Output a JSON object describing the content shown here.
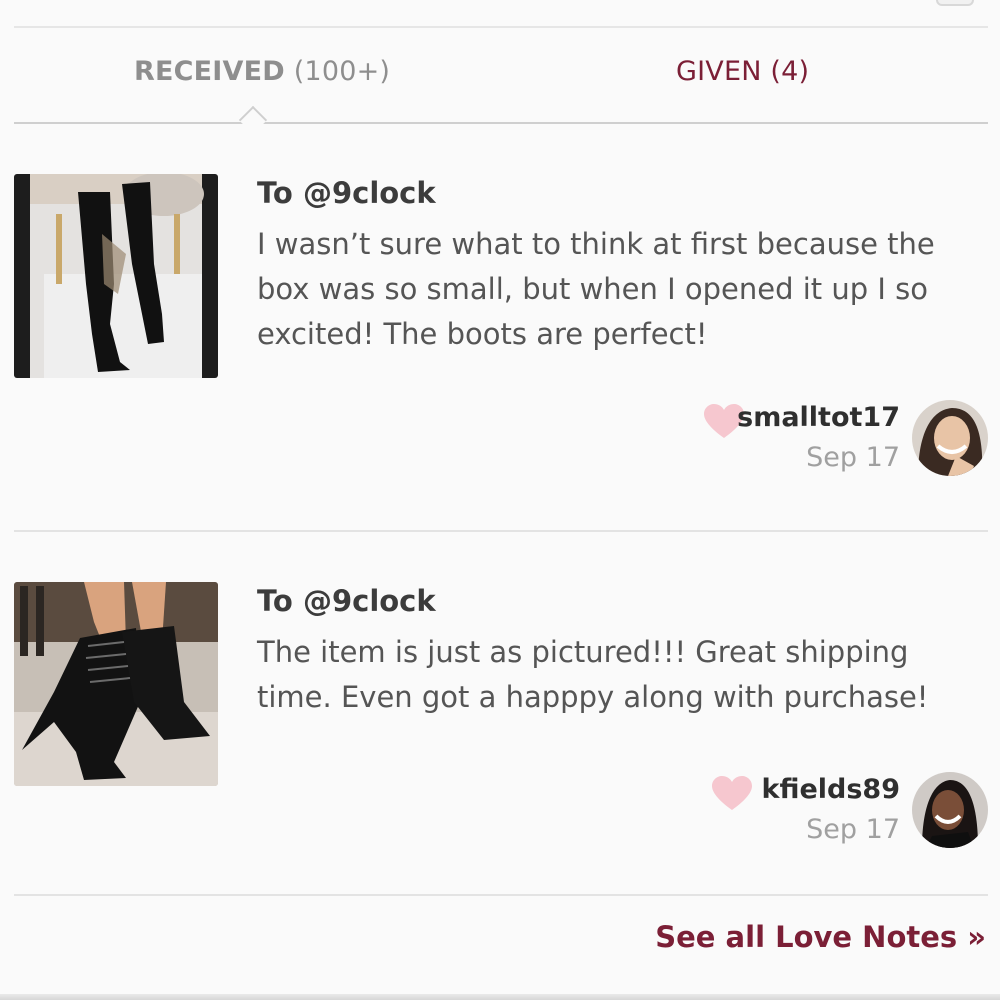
{
  "tabs": {
    "received_name": "RECEIVED",
    "received_count": "(100+)",
    "given": "GIVEN (4)"
  },
  "notes": [
    {
      "to": "To @9clock",
      "text": "I wasn’t sure what to think at first because the box was so small, but when I opened it up I so excited! The boots are perfect!",
      "username": "smalltot17",
      "date": "Sep 17",
      "thumb_icon": "over-the-knee-black-boots-photo",
      "avatar_icon": "smiling-woman-avatar"
    },
    {
      "to": "To @9clock",
      "text": "The item is just as pictured!!! Great shipping time. Even got a happpy along with purchase!",
      "username": "kfields89",
      "date": "Sep 17",
      "thumb_icon": "black-lace-up-heels-photo",
      "avatar_icon": "smiling-woman-avatar"
    }
  ],
  "footer": {
    "see_all": "See all Love Notes »"
  },
  "colors": {
    "accent": "#7b1f36",
    "heart": "#f6c7cf",
    "muted": "#8e8e8e"
  }
}
